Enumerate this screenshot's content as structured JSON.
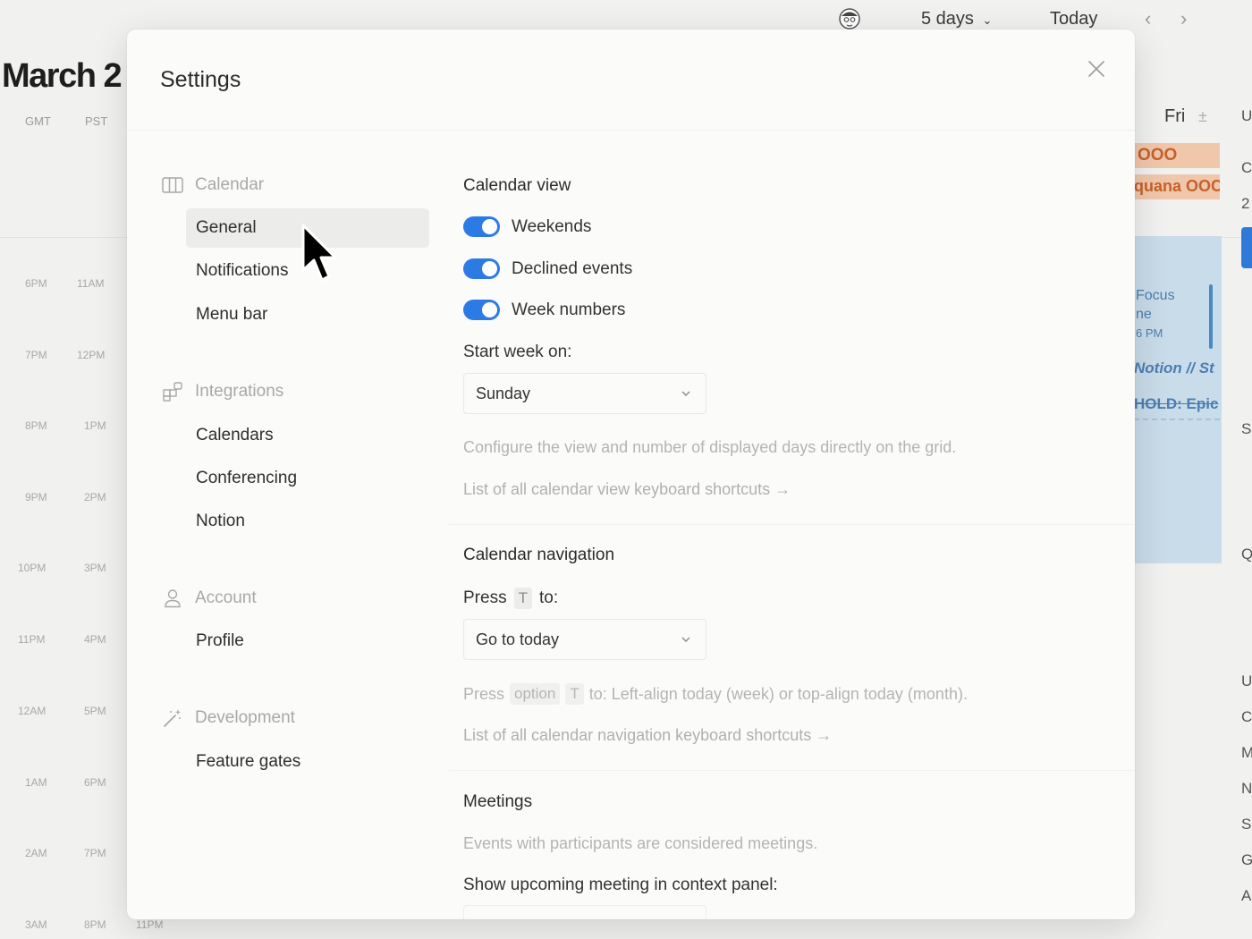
{
  "background": {
    "month_title": "March 2",
    "timezones": [
      "GMT",
      "PST"
    ],
    "times_gmt": [
      "6PM",
      "7PM",
      "8PM",
      "9PM",
      "10PM",
      "11PM",
      "12AM",
      "1AM",
      "2AM",
      "3AM"
    ],
    "times_pst": [
      "11AM",
      "12PM",
      "1PM",
      "2PM",
      "3PM",
      "4PM",
      "5PM",
      "6PM",
      "7PM",
      "8PM"
    ],
    "third_tz_time": "11PM",
    "range_label": "5 days",
    "today_label": "Today",
    "day_header": "Fri",
    "day_header_add": "±",
    "events": {
      "ooo1": "OOO",
      "ooo2": "quana OOC",
      "focus_line1": "Focus",
      "focus_line2": "ne",
      "focus_time": "6 PM",
      "notion": "Notion // St",
      "hold": "HOLD: Epic"
    },
    "edge_letters": [
      "U",
      "C",
      "2",
      "S",
      "Q",
      "U",
      "C",
      "M",
      "N",
      "S",
      "G",
      "A"
    ]
  },
  "modal": {
    "title": "Settings",
    "sidebar": {
      "groups": [
        {
          "header": "Calendar",
          "icon": "columns-icon",
          "items": [
            "General",
            "Notifications",
            "Menu bar"
          ]
        },
        {
          "header": "Integrations",
          "icon": "integrations-icon",
          "items": [
            "Calendars",
            "Conferencing",
            "Notion"
          ]
        },
        {
          "header": "Account",
          "icon": "person-icon",
          "items": [
            "Profile"
          ]
        },
        {
          "header": "Development",
          "icon": "magic-wand-icon",
          "items": [
            "Feature gates"
          ]
        }
      ],
      "active_item": "General"
    },
    "content": {
      "calendar_view": {
        "title": "Calendar view",
        "toggles": [
          {
            "label": "Weekends",
            "on": true
          },
          {
            "label": "Declined events",
            "on": true
          },
          {
            "label": "Week numbers",
            "on": true
          }
        ],
        "start_week_label": "Start week on:",
        "start_week_value": "Sunday",
        "help": "Configure the view and number of displayed days directly on the grid.",
        "shortcuts_link": "List of all calendar view keyboard shortcuts →"
      },
      "calendar_navigation": {
        "title": "Calendar navigation",
        "press_label": "Press",
        "press_key": "T",
        "press_suffix": "to:",
        "press_value": "Go to today",
        "help_prefix": "Press",
        "help_key1": "option",
        "help_key2": "T",
        "help_suffix": "to: Left-align today (week) or top-align today (month).",
        "shortcuts_link": "List of all calendar navigation keyboard shortcuts →"
      },
      "meetings": {
        "title": "Meetings",
        "help": "Events with participants are considered meetings.",
        "upcoming_label": "Show upcoming meeting in context panel:"
      }
    },
    "colors": {
      "accent": "#2c7be5",
      "ooo": "#f1c7ac",
      "event_blue": "#c9dcea"
    }
  }
}
